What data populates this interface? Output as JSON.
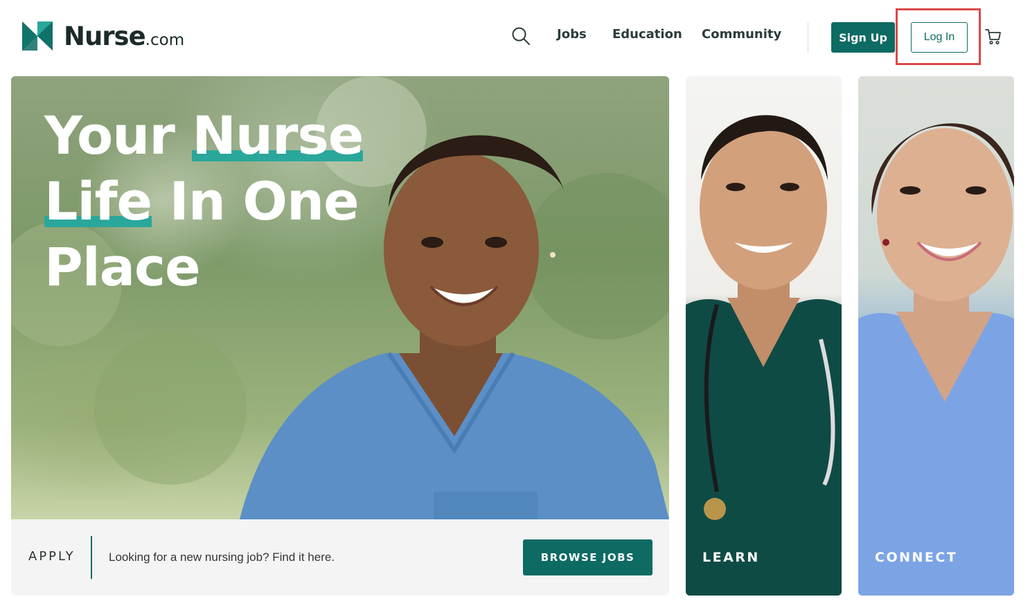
{
  "brand": {
    "name": "Nurse",
    "tld": ".com",
    "icon": "nurse-logo-icon",
    "colors": {
      "primary": "#0d6b63",
      "accent": "#2aa79b",
      "highlight_box": "#d94848"
    }
  },
  "nav": {
    "search_icon": "search-icon",
    "items": [
      {
        "label": "Jobs"
      },
      {
        "label": "Education"
      },
      {
        "label": "Community"
      }
    ],
    "signup_label": "Sign Up",
    "login_label": "Log In",
    "cart_icon": "cart-icon"
  },
  "hero": {
    "headline": {
      "line1_plain": "Your ",
      "line1_highlight": "Nurse",
      "line2_highlight": "Life",
      "line2_plain": " In One",
      "line3_plain": "Place"
    },
    "apply": {
      "label": "APPLY",
      "text": "Looking for a new nursing job? Find it here.",
      "button_label": "BROWSE JOBS"
    }
  },
  "cards": [
    {
      "label": "LEARN"
    },
    {
      "label": "CONNECT"
    }
  ]
}
